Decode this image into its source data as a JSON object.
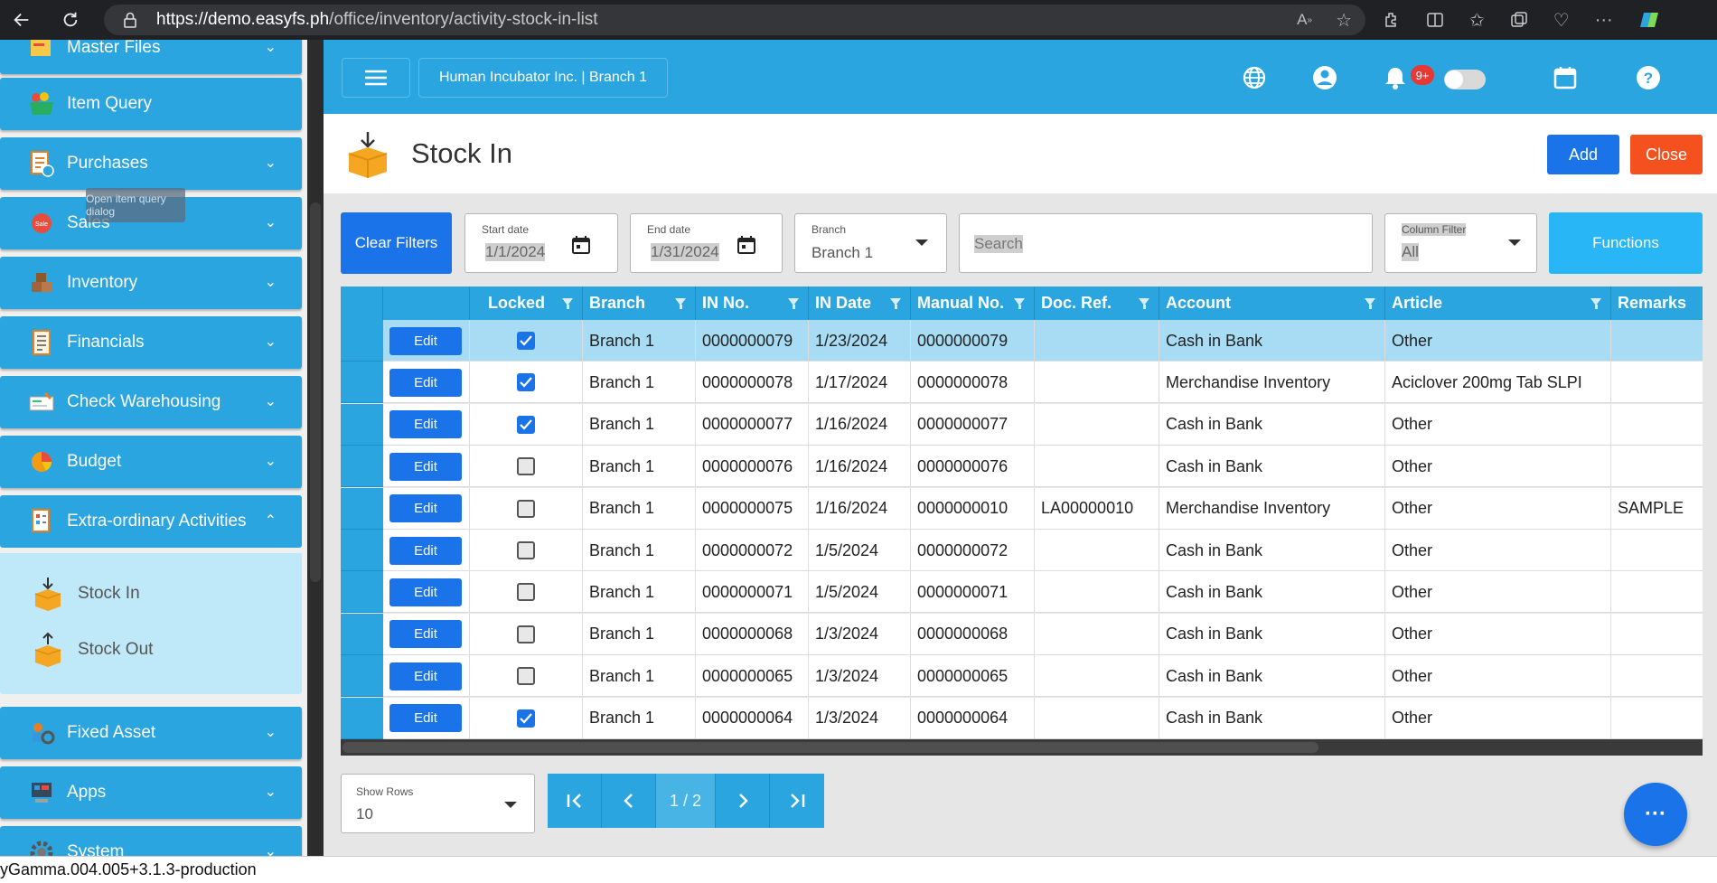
{
  "browser": {
    "url_host": "https://demo.easyfs.ph",
    "url_path": "/office/inventory/activity-stock-in-list"
  },
  "sidebar": {
    "items": [
      {
        "label": "Master Files",
        "icon": "folder-icon"
      },
      {
        "label": "Item Query",
        "icon": "basket-icon"
      },
      {
        "label": "Purchases",
        "icon": "clipboard-icon"
      },
      {
        "label": "Sales",
        "icon": "sale-tag-icon"
      },
      {
        "label": "Inventory",
        "icon": "boxes-icon"
      },
      {
        "label": "Financials",
        "icon": "ledger-icon"
      },
      {
        "label": "Check Warehousing",
        "icon": "check-icon"
      },
      {
        "label": "Budget",
        "icon": "pie-chart-icon"
      },
      {
        "label": "Extra-ordinary Activities",
        "icon": "activities-icon"
      },
      {
        "label": "Fixed Asset",
        "icon": "asset-gear-icon"
      },
      {
        "label": "Apps",
        "icon": "apps-icon"
      },
      {
        "label": "System",
        "icon": "system-gear-icon"
      }
    ],
    "sub_items": [
      {
        "label": "Stock In",
        "icon": "box-in-icon"
      },
      {
        "label": "Stock Out",
        "icon": "box-out-icon"
      }
    ],
    "tooltip": "Open item query dialog"
  },
  "header": {
    "company": "Human Incubator Inc. | Branch 1",
    "notification_badge": "9+"
  },
  "page": {
    "title": "Stock In",
    "add_label": "Add",
    "close_label": "Close"
  },
  "filters": {
    "clear_label": "Clear Filters",
    "start_date_label": "Start date",
    "start_date": "1/1/2024",
    "end_date_label": "End date",
    "end_date": "1/31/2024",
    "branch_label": "Branch",
    "branch": "Branch 1",
    "search_placeholder": "Search",
    "column_filter_label": "Column Filter",
    "column_filter": "All",
    "functions_label": "Functions"
  },
  "table": {
    "columns": [
      "Locked",
      "Branch",
      "IN No.",
      "IN Date",
      "Manual No.",
      "Doc. Ref.",
      "Account",
      "Article",
      "Remarks"
    ],
    "edit_label": "Edit",
    "rows": [
      {
        "locked": true,
        "branch": "Branch 1",
        "in_no": "0000000079",
        "in_date": "1/23/2024",
        "manual_no": "0000000079",
        "doc_ref": "",
        "account": "Cash in Bank",
        "article": "Other",
        "remarks": ""
      },
      {
        "locked": true,
        "branch": "Branch 1",
        "in_no": "0000000078",
        "in_date": "1/17/2024",
        "manual_no": "0000000078",
        "doc_ref": "",
        "account": "Merchandise Inventory",
        "article": "Aciclover 200mg Tab SLPI",
        "remarks": ""
      },
      {
        "locked": true,
        "branch": "Branch 1",
        "in_no": "0000000077",
        "in_date": "1/16/2024",
        "manual_no": "0000000077",
        "doc_ref": "",
        "account": "Cash in Bank",
        "article": "Other",
        "remarks": ""
      },
      {
        "locked": false,
        "branch": "Branch 1",
        "in_no": "0000000076",
        "in_date": "1/16/2024",
        "manual_no": "0000000076",
        "doc_ref": "",
        "account": "Cash in Bank",
        "article": "Other",
        "remarks": ""
      },
      {
        "locked": false,
        "branch": "Branch 1",
        "in_no": "0000000075",
        "in_date": "1/16/2024",
        "manual_no": "0000000010",
        "doc_ref": "LA00000010",
        "account": "Merchandise Inventory",
        "article": "Other",
        "remarks": "SAMPLE"
      },
      {
        "locked": false,
        "branch": "Branch 1",
        "in_no": "0000000072",
        "in_date": "1/5/2024",
        "manual_no": "0000000072",
        "doc_ref": "",
        "account": "Cash in Bank",
        "article": "Other",
        "remarks": ""
      },
      {
        "locked": false,
        "branch": "Branch 1",
        "in_no": "0000000071",
        "in_date": "1/5/2024",
        "manual_no": "0000000071",
        "doc_ref": "",
        "account": "Cash in Bank",
        "article": "Other",
        "remarks": ""
      },
      {
        "locked": false,
        "branch": "Branch 1",
        "in_no": "0000000068",
        "in_date": "1/3/2024",
        "manual_no": "0000000068",
        "doc_ref": "",
        "account": "Cash in Bank",
        "article": "Other",
        "remarks": ""
      },
      {
        "locked": false,
        "branch": "Branch 1",
        "in_no": "0000000065",
        "in_date": "1/3/2024",
        "manual_no": "0000000065",
        "doc_ref": "",
        "account": "Cash in Bank",
        "article": "Other",
        "remarks": ""
      },
      {
        "locked": true,
        "branch": "Branch 1",
        "in_no": "0000000064",
        "in_date": "1/3/2024",
        "manual_no": "0000000064",
        "doc_ref": "",
        "account": "Cash in Bank",
        "article": "Other",
        "remarks": ""
      }
    ]
  },
  "pager": {
    "show_rows_label": "Show Rows",
    "show_rows": "10",
    "page": "1 / 2"
  },
  "status": {
    "version": "yGamma.004.005+3.1.3-production"
  },
  "colors": {
    "primary": "#2aa5e0",
    "button_blue": "#1a73e8",
    "close_orange": "#f4511e",
    "selected_row": "#a8dcf4"
  }
}
